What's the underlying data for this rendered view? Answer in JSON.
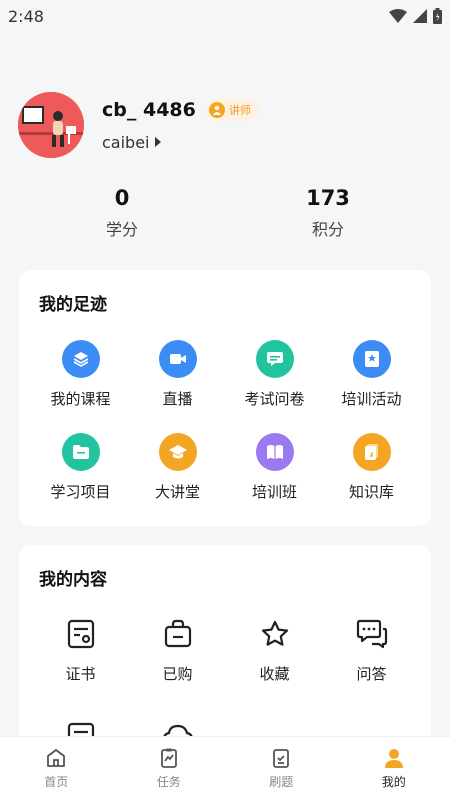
{
  "status": {
    "time": "2:48"
  },
  "profile": {
    "username": "cb_ 4486",
    "role_badge": "讲师",
    "account": "caibei"
  },
  "stats": [
    {
      "value": "0",
      "label": "学分"
    },
    {
      "value": "173",
      "label": "积分"
    }
  ],
  "footprint": {
    "title": "我的足迹",
    "items": [
      {
        "label": "我的课程",
        "icon": "layers-icon",
        "color": "#3b8df5"
      },
      {
        "label": "直播",
        "icon": "video-icon",
        "color": "#3b8df5"
      },
      {
        "label": "考试问卷",
        "icon": "message-icon",
        "color": "#22c4a0"
      },
      {
        "label": "培训活动",
        "icon": "bookmark-icon",
        "color": "#3b8df5"
      },
      {
        "label": "学习项目",
        "icon": "folder-icon",
        "color": "#22c4a0"
      },
      {
        "label": "大讲堂",
        "icon": "graduation-cap-icon",
        "color": "#f5a524"
      },
      {
        "label": "培训班",
        "icon": "book-icon",
        "color": "#9b79f0"
      },
      {
        "label": "知识库",
        "icon": "document-icon",
        "color": "#f5a524"
      }
    ]
  },
  "content": {
    "title": "我的内容",
    "items": [
      {
        "label": "证书",
        "icon": "certificate-icon"
      },
      {
        "label": "已购",
        "icon": "shopping-bag-icon"
      },
      {
        "label": "收藏",
        "icon": "star-icon"
      },
      {
        "label": "问答",
        "icon": "chat-icon"
      }
    ]
  },
  "tabbar": {
    "active_color": "#f5a524",
    "tabs": [
      {
        "label": "首页",
        "icon": "home-icon"
      },
      {
        "label": "任务",
        "icon": "clipboard-chart-icon"
      },
      {
        "label": "刷题",
        "icon": "checklist-icon"
      },
      {
        "label": "我的",
        "icon": "person-icon"
      }
    ]
  }
}
